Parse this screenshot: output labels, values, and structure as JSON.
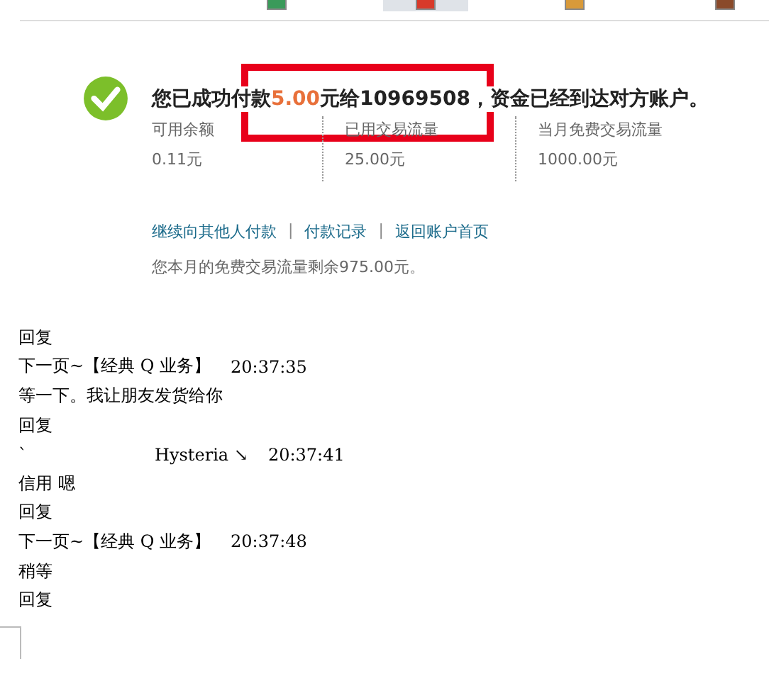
{
  "tabs": [
    {
      "selected": false
    },
    {
      "selected": true
    },
    {
      "selected": false
    },
    {
      "selected": false
    }
  ],
  "result": {
    "amount": "5.00",
    "separator": "|",
    "pre": "您已成功付款",
    "post": "元给10969508，资金已经到达对方账户。",
    "stats": [
      {
        "label": "可用余额",
        "value": "0.11元"
      },
      {
        "label": "已用交易流量",
        "value": "25.00元"
      },
      {
        "label": "当月免费交易流量",
        "value": "1000.00元"
      }
    ],
    "links": [
      "继续向其他人付款",
      "付款记录",
      "返回账户首页"
    ],
    "note": "您本月的免费交易流量剩余975.00元。"
  },
  "chat": [
    {
      "kind": "reply",
      "text": "回复"
    },
    {
      "kind": "header",
      "name": "下一页~【经典 Q 业务】",
      "time": "20:37:35"
    },
    {
      "kind": "message",
      "text": "等一下。我让朋友发货给你"
    },
    {
      "kind": "reply",
      "text": "回复"
    },
    {
      "kind": "header",
      "mark": "`",
      "name": "Hysteria ↘",
      "time": "20:37:41"
    },
    {
      "kind": "message",
      "text": "信用  嗯"
    },
    {
      "kind": "reply",
      "text": "回复"
    },
    {
      "kind": "header",
      "name": "下一页~【经典 Q 业务】",
      "time": "20:37:48"
    },
    {
      "kind": "message",
      "text": "稍等"
    },
    {
      "kind": "reply",
      "text": "回复"
    }
  ]
}
